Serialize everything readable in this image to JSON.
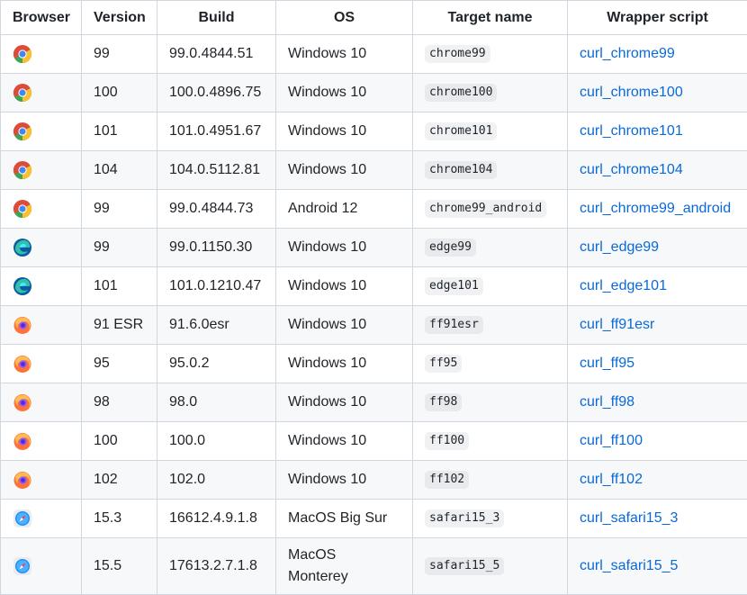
{
  "table": {
    "headers": [
      "Browser",
      "Version",
      "Build",
      "OS",
      "Target name",
      "Wrapper script"
    ],
    "rows": [
      {
        "browser_icon": "chrome-icon",
        "version": "99",
        "build": "99.0.4844.51",
        "os": "Windows 10",
        "target": "chrome99",
        "wrapper": "curl_chrome99"
      },
      {
        "browser_icon": "chrome-icon",
        "version": "100",
        "build": "100.0.4896.75",
        "os": "Windows 10",
        "target": "chrome100",
        "wrapper": "curl_chrome100"
      },
      {
        "browser_icon": "chrome-icon",
        "version": "101",
        "build": "101.0.4951.67",
        "os": "Windows 10",
        "target": "chrome101",
        "wrapper": "curl_chrome101"
      },
      {
        "browser_icon": "chrome-icon",
        "version": "104",
        "build": "104.0.5112.81",
        "os": "Windows 10",
        "target": "chrome104",
        "wrapper": "curl_chrome104"
      },
      {
        "browser_icon": "chrome-icon",
        "version": "99",
        "build": "99.0.4844.73",
        "os": "Android 12",
        "target": "chrome99_android",
        "wrapper": "curl_chrome99_android"
      },
      {
        "browser_icon": "edge-icon",
        "version": "99",
        "build": "99.0.1150.30",
        "os": "Windows 10",
        "target": "edge99",
        "wrapper": "curl_edge99"
      },
      {
        "browser_icon": "edge-icon",
        "version": "101",
        "build": "101.0.1210.47",
        "os": "Windows 10",
        "target": "edge101",
        "wrapper": "curl_edge101"
      },
      {
        "browser_icon": "firefox-icon",
        "version": "91 ESR",
        "build": "91.6.0esr",
        "os": "Windows 10",
        "target": "ff91esr",
        "wrapper": "curl_ff91esr"
      },
      {
        "browser_icon": "firefox-icon",
        "version": "95",
        "build": "95.0.2",
        "os": "Windows 10",
        "target": "ff95",
        "wrapper": "curl_ff95"
      },
      {
        "browser_icon": "firefox-icon",
        "version": "98",
        "build": "98.0",
        "os": "Windows 10",
        "target": "ff98",
        "wrapper": "curl_ff98"
      },
      {
        "browser_icon": "firefox-icon",
        "version": "100",
        "build": "100.0",
        "os": "Windows 10",
        "target": "ff100",
        "wrapper": "curl_ff100"
      },
      {
        "browser_icon": "firefox-icon",
        "version": "102",
        "build": "102.0",
        "os": "Windows 10",
        "target": "ff102",
        "wrapper": "curl_ff102"
      },
      {
        "browser_icon": "safari-icon",
        "version": "15.3",
        "build": "16612.4.9.1.8",
        "os": "MacOS Big Sur",
        "target": "safari15_3",
        "wrapper": "curl_safari15_3"
      },
      {
        "browser_icon": "safari-icon",
        "version": "15.5",
        "build": "17613.2.7.1.8",
        "os": "MacOS Monterey",
        "target": "safari15_5",
        "wrapper": "curl_safari15_5"
      }
    ]
  },
  "colors": {
    "link": "#0969da",
    "border": "#d0d7de",
    "zebra": "#f6f8fa",
    "text": "#1f2328"
  }
}
